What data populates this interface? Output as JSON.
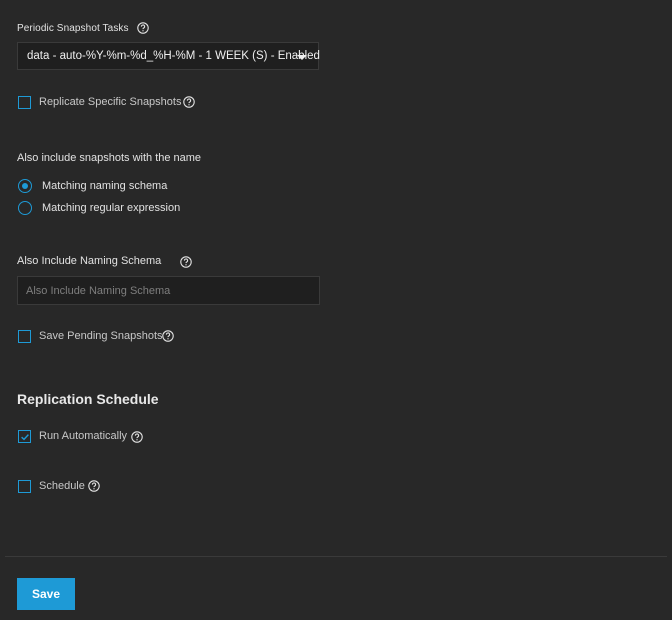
{
  "periodic_snapshot_tasks": {
    "label": "Periodic Snapshot Tasks",
    "selected_value": "data - auto-%Y-%m-%d_%H-%M - 1 WEEK (S) - Enabled"
  },
  "replicate_specific_snapshots": {
    "label": "Replicate Specific Snapshots",
    "checked": false
  },
  "also_include_name": {
    "label": "Also include snapshots with the name",
    "options": [
      {
        "label": "Matching naming schema",
        "selected": true
      },
      {
        "label": "Matching regular expression",
        "selected": false
      }
    ]
  },
  "naming_schema": {
    "label": "Also Include Naming Schema",
    "placeholder": "Also Include Naming Schema",
    "value": ""
  },
  "save_pending_snapshots": {
    "label": "Save Pending Snapshots",
    "checked": false
  },
  "replication_schedule": {
    "heading": "Replication Schedule",
    "run_automatically": {
      "label": "Run Automatically",
      "checked": true
    },
    "schedule": {
      "label": "Schedule",
      "checked": false
    }
  },
  "footer": {
    "save_label": "Save"
  },
  "colors": {
    "accent": "#1e9ad6",
    "background": "#282828",
    "input_background": "#1f1f1f"
  }
}
